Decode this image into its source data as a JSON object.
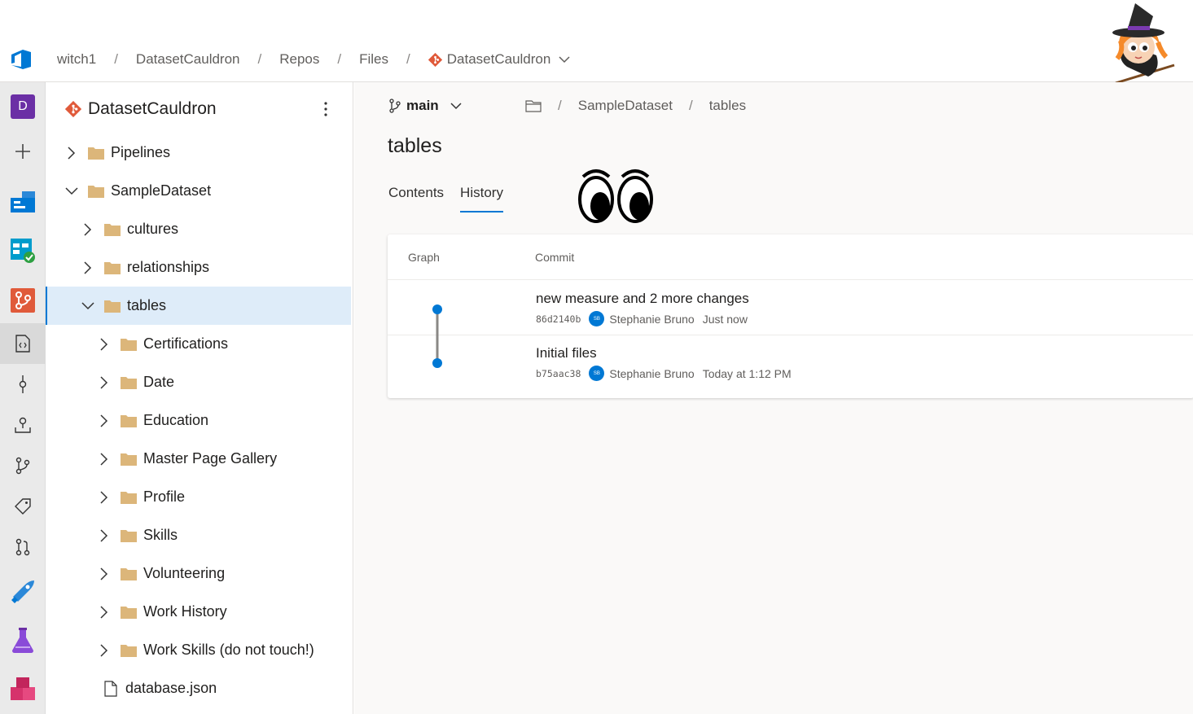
{
  "header": {
    "breadcrumbs": [
      "witch1",
      "DatasetCauldron",
      "Repos",
      "Files"
    ],
    "repo_selector": "DatasetCauldron",
    "separator": "/"
  },
  "rail": {
    "org_initial": "D",
    "items": [
      {
        "icon": "plus-icon"
      },
      {
        "icon": "overview-icon"
      },
      {
        "icon": "boards-icon"
      },
      {
        "icon": "repos-icon"
      },
      {
        "icon": "files-icon"
      },
      {
        "icon": "commits-icon"
      },
      {
        "icon": "pushes-icon"
      },
      {
        "icon": "branches-icon"
      },
      {
        "icon": "tags-icon"
      },
      {
        "icon": "pull-requests-icon"
      },
      {
        "icon": "pipelines-icon"
      },
      {
        "icon": "test-plans-icon"
      },
      {
        "icon": "artifacts-icon"
      }
    ]
  },
  "tree": {
    "repo_name": "DatasetCauldron",
    "items": [
      {
        "label": "Pipelines",
        "type": "folder",
        "depth": 0,
        "expanded": false
      },
      {
        "label": "SampleDataset",
        "type": "folder",
        "depth": 0,
        "expanded": true
      },
      {
        "label": "cultures",
        "type": "folder",
        "depth": 1,
        "expanded": false
      },
      {
        "label": "relationships",
        "type": "folder",
        "depth": 1,
        "expanded": false
      },
      {
        "label": "tables",
        "type": "folder",
        "depth": 1,
        "expanded": true,
        "selected": true
      },
      {
        "label": "Certifications",
        "type": "folder",
        "depth": 2,
        "expanded": false
      },
      {
        "label": "Date",
        "type": "folder",
        "depth": 2,
        "expanded": false
      },
      {
        "label": "Education",
        "type": "folder",
        "depth": 2,
        "expanded": false
      },
      {
        "label": "Master Page Gallery",
        "type": "folder",
        "depth": 2,
        "expanded": false
      },
      {
        "label": "Profile",
        "type": "folder",
        "depth": 2,
        "expanded": false
      },
      {
        "label": "Skills",
        "type": "folder",
        "depth": 2,
        "expanded": false
      },
      {
        "label": "Volunteering",
        "type": "folder",
        "depth": 2,
        "expanded": false
      },
      {
        "label": "Work History",
        "type": "folder",
        "depth": 2,
        "expanded": false
      },
      {
        "label": "Work Skills (do not touch!)",
        "type": "folder",
        "depth": 2,
        "expanded": false
      },
      {
        "label": "database.json",
        "type": "file",
        "depth": 1
      }
    ]
  },
  "main": {
    "branch": "main",
    "path": [
      "SampleDataset",
      "tables"
    ],
    "title": "tables",
    "tabs": [
      {
        "label": "Contents",
        "active": false
      },
      {
        "label": "History",
        "active": true
      }
    ],
    "history": {
      "columns": {
        "graph": "Graph",
        "commit": "Commit"
      },
      "commits": [
        {
          "message": "new measure and 2 more changes",
          "hash": "86d2140b",
          "avatar": "SB",
          "author": "Stephanie Bruno",
          "time": "Just now"
        },
        {
          "message": "Initial files",
          "hash": "b75aac38",
          "avatar": "SB",
          "author": "Stephanie Bruno",
          "time": "Today at 1:12 PM"
        }
      ]
    }
  },
  "colors": {
    "accent": "#0078d4",
    "folder": "#dcb67a",
    "git": "#e05a3a",
    "org": "#6b2fa5",
    "selected_row": "#deecf9"
  }
}
